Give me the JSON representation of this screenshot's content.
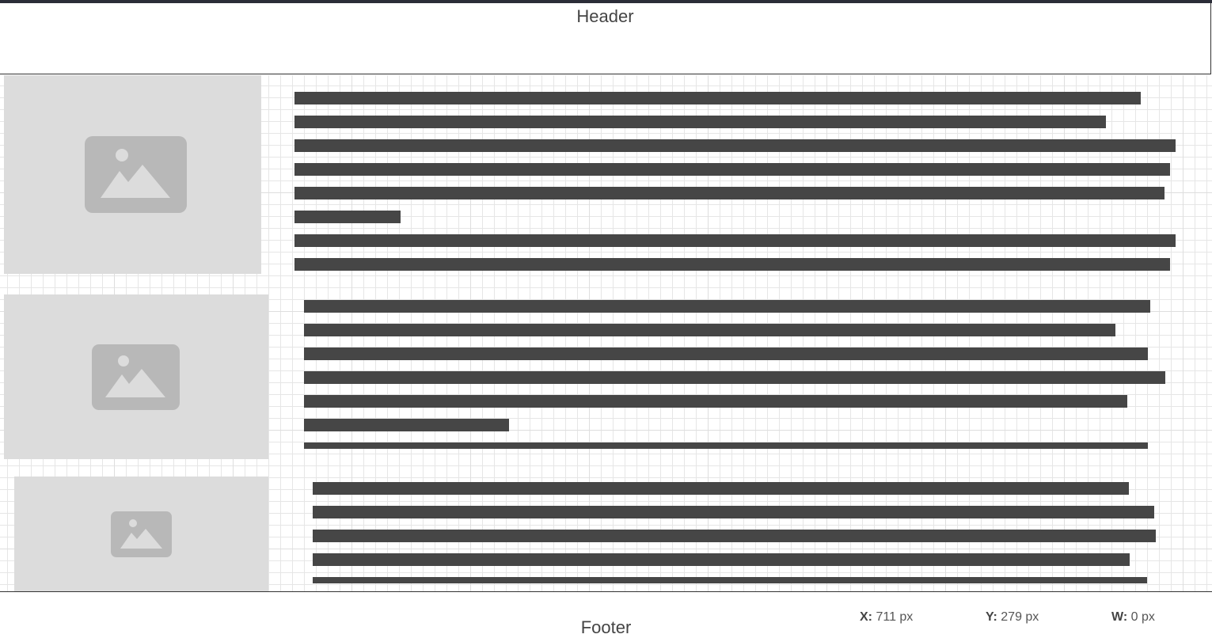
{
  "header": {
    "title": "Header"
  },
  "footer": {
    "title": "Footer",
    "readouts": [
      {
        "label": "X",
        "value": "711 px"
      },
      {
        "label": "Y",
        "value": "279 px"
      },
      {
        "label": "W",
        "value": "0 px"
      }
    ]
  },
  "placeholders": [
    {
      "icon": "image-icon"
    },
    {
      "icon": "image-icon"
    },
    {
      "icon": "image-icon"
    }
  ],
  "colors": {
    "text_bar": "#464646",
    "placeholder_bg": "#dcdcdc",
    "placeholder_icon": "#b8b8b8",
    "top_bar": "#2b2d38"
  }
}
